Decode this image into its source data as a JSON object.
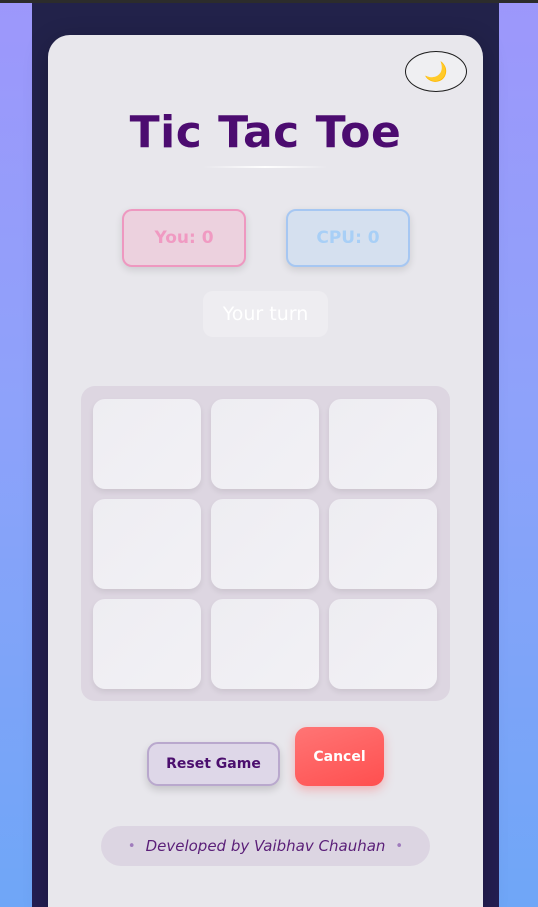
{
  "header": {
    "title": "Tic Tac Toe",
    "theme_toggle_icon": "🌙"
  },
  "scores": {
    "you": "You: 0",
    "cpu": "CPU: 0"
  },
  "status": {
    "turn": "Your turn"
  },
  "board": {
    "cells": [
      "",
      "",
      "",
      "",
      "",
      "",
      "",
      "",
      ""
    ]
  },
  "actions": {
    "reset": "Reset Game",
    "cancel": "Cancel"
  },
  "footer": {
    "credit": "Developed by Vaibhav Chauhan",
    "dot": "•"
  },
  "colors": {
    "title": "#4c0c70",
    "you_score": "#f09ac2",
    "cpu_score": "#a8cff6",
    "cancel": "#ff5e5e"
  }
}
